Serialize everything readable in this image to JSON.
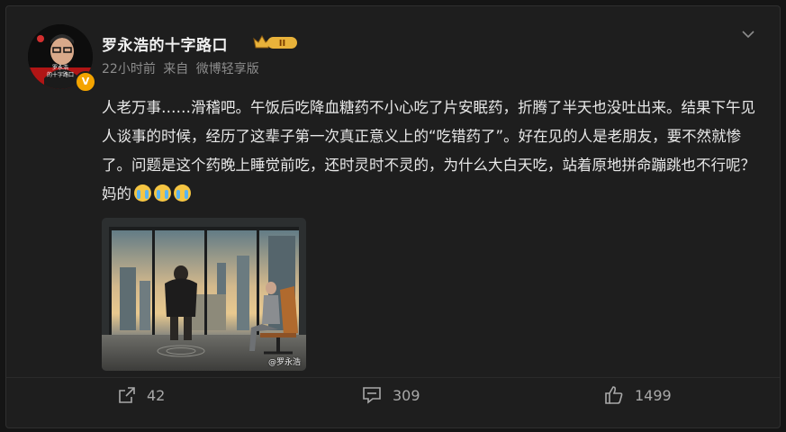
{
  "post": {
    "username": "罗永浩的十字路口",
    "rank_badge": "II",
    "time": "22小时前",
    "source_prefix": "来自",
    "source": "微博轻享版",
    "text": "人老万事……滑稽吧。午饭后吃降血糖药不小心吃了片安眠药，折腾了半天也没吐出来。结果下午见人谈事的时候，经历了这辈子第一次真正意义上的“吃错药了”。好在见的人是老朋友，要不然就惨了。问题是这个药晚上睡觉前吃，还时灵时不灵的，为什么大白天吃，站着原地拼命蹦跳也不行呢？妈的",
    "emojis": [
      "crying-emoji",
      "crying-emoji",
      "crying-emoji"
    ],
    "avatar_caption_top": "罗永浩",
    "avatar_caption_bottom": "的十字路口",
    "image_watermark": "@罗永浩",
    "verified_badge": "V"
  },
  "actions": {
    "share_count": "42",
    "comment_count": "309",
    "like_count": "1499"
  },
  "colors": {
    "background": "#151515",
    "card": "#1e1e1e",
    "text": "#e8e8e8",
    "muted": "#8c8c8c",
    "verified": "#f4a400"
  }
}
